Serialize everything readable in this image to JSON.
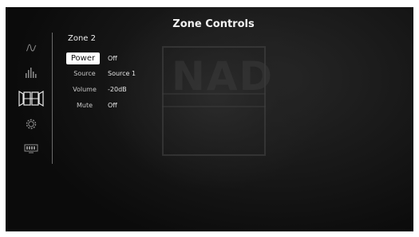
{
  "header": {
    "title": "Zone Controls"
  },
  "zone": {
    "title": "Zone 2",
    "rows": [
      {
        "label": "Power",
        "value": "Off"
      },
      {
        "label": "Source",
        "value": "Source 1"
      },
      {
        "label": "Volume",
        "value": "-20dB"
      },
      {
        "label": "Mute",
        "value": "Off"
      }
    ]
  },
  "sidebar": {
    "items": [
      {
        "icon": "waveform-icon"
      },
      {
        "icon": "equalizer-icon"
      },
      {
        "icon": "zones-icon",
        "selected": true
      },
      {
        "icon": "gear-icon"
      },
      {
        "icon": "display-icon"
      }
    ]
  },
  "watermark": {
    "text": "NAD"
  },
  "colors": {
    "background": "#161616",
    "selected": "#ffffff",
    "icon": "#8c8c8c",
    "text": "#e6e6e6"
  }
}
